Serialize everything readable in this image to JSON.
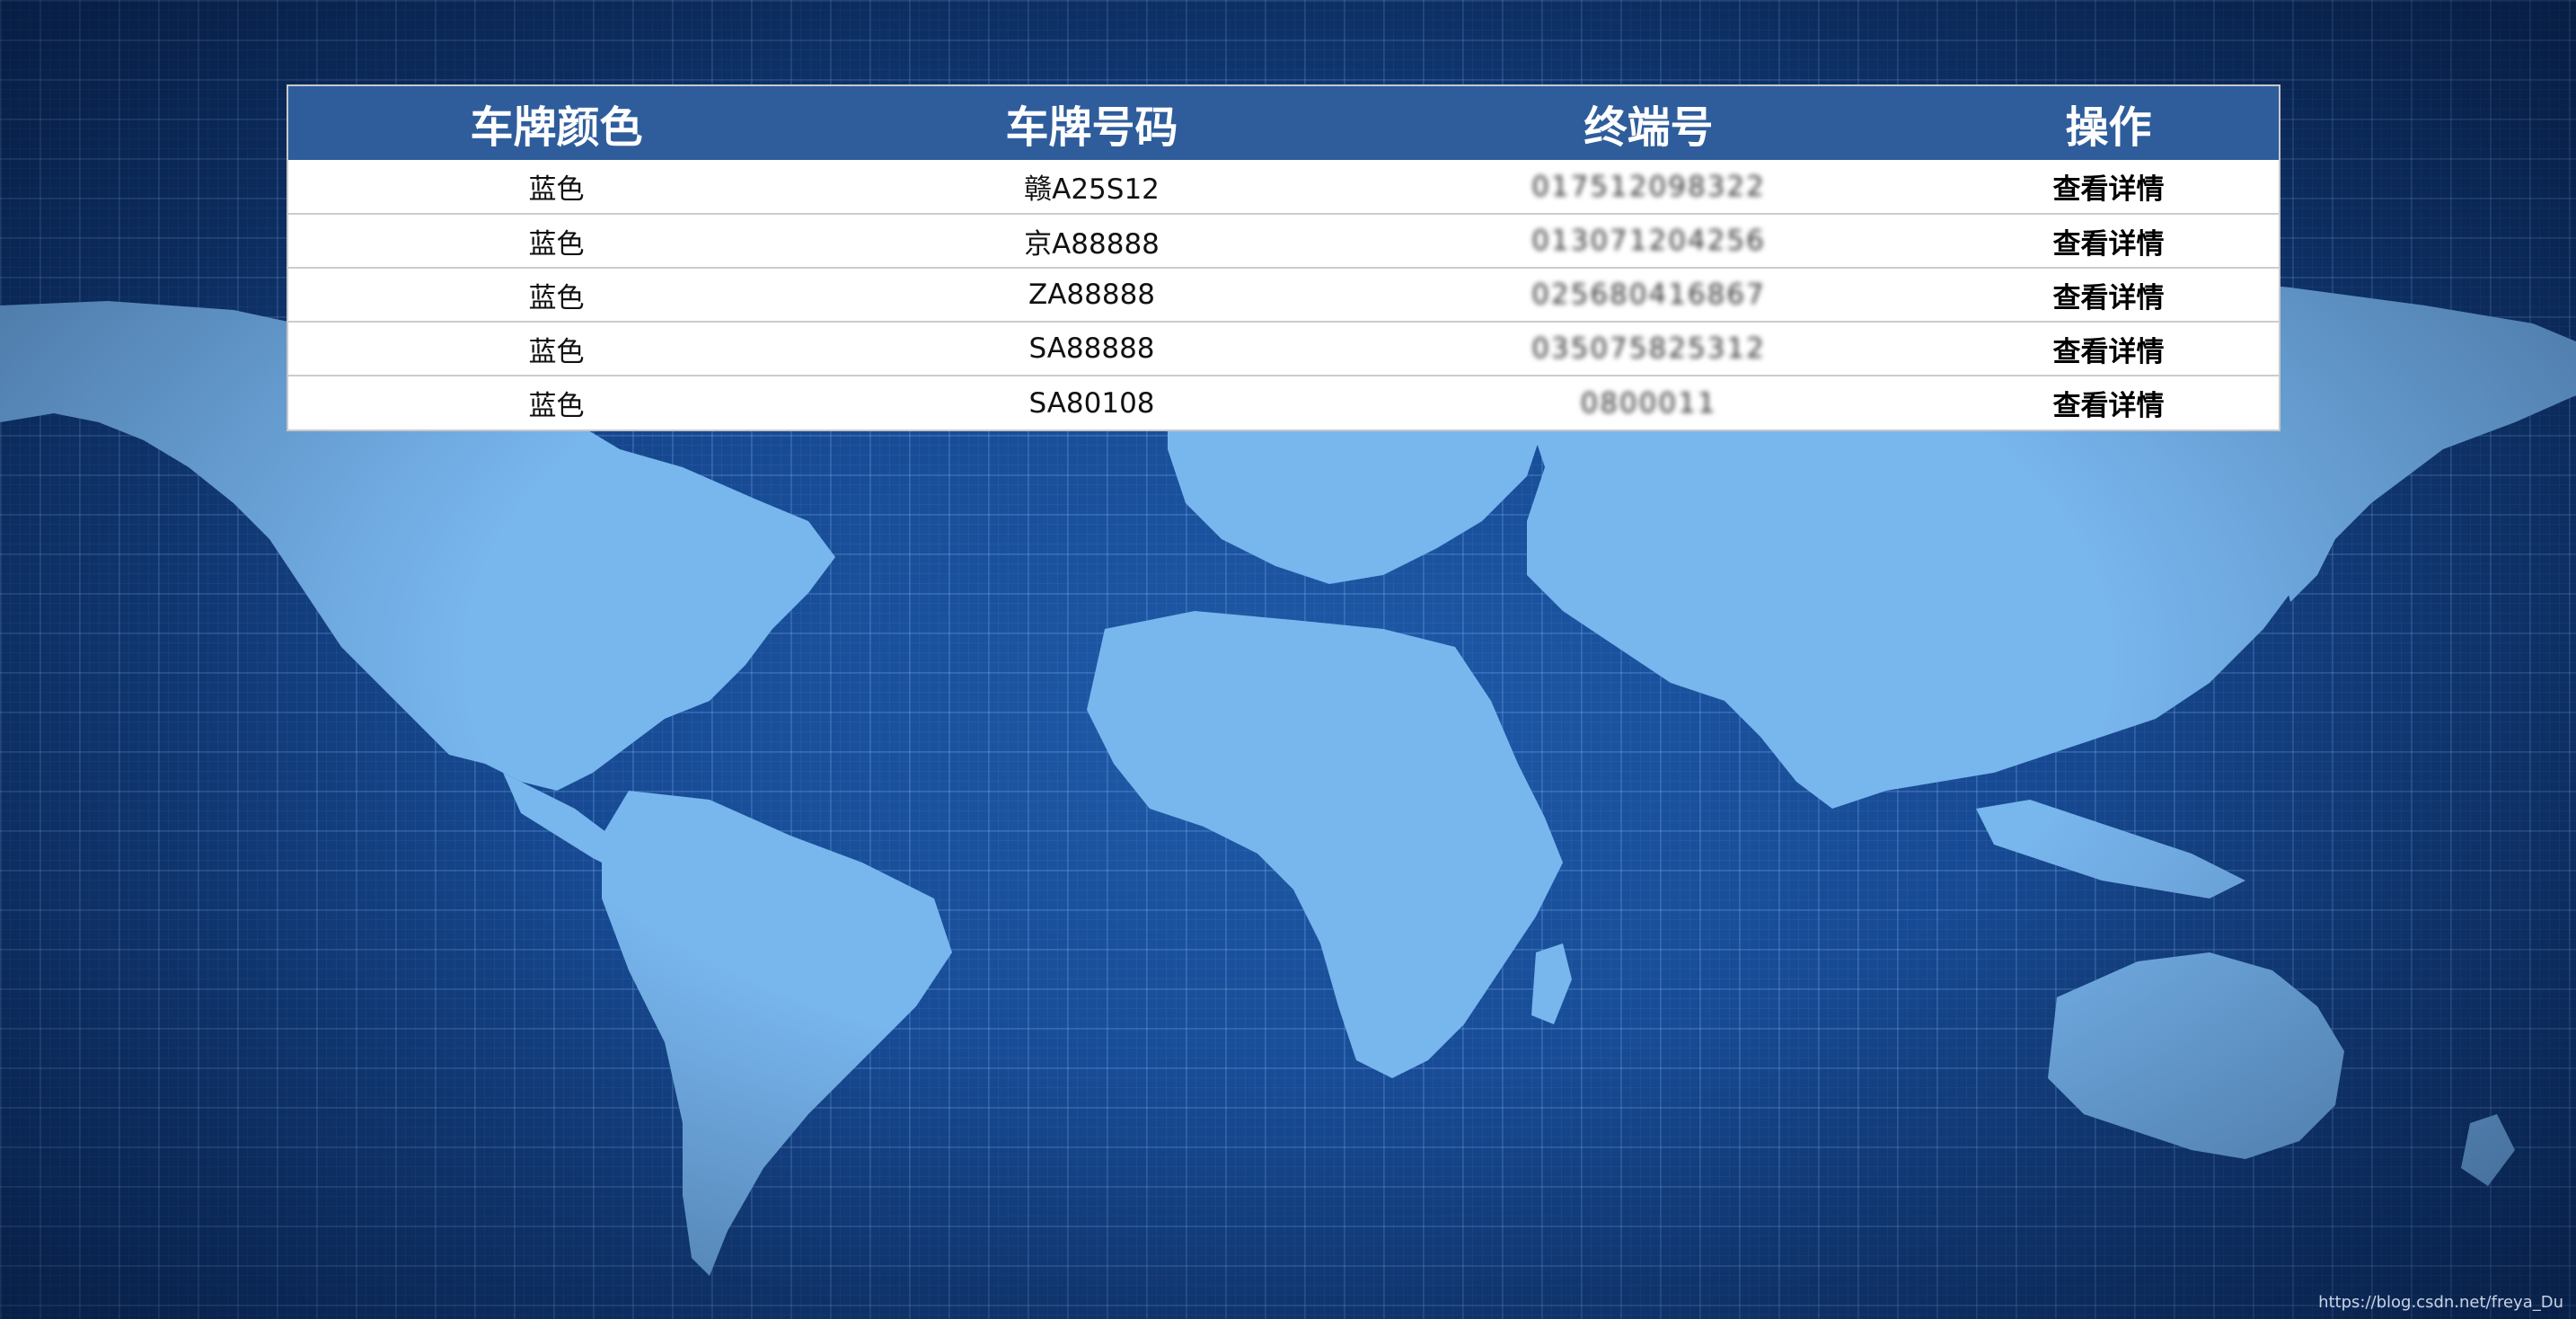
{
  "table": {
    "headers": [
      "车牌颜色",
      "车牌号码",
      "终端号",
      "操作"
    ],
    "rows": [
      {
        "color": "蓝色",
        "plate": "赣A25S12",
        "terminal": "017512098322",
        "action": "查看详情"
      },
      {
        "color": "蓝色",
        "plate": "京A88888",
        "terminal": "013071204256",
        "action": "查看详情"
      },
      {
        "color": "蓝色",
        "plate": "ZA88888",
        "terminal": "025680416867",
        "action": "查看详情"
      },
      {
        "color": "蓝色",
        "plate": "SA88888",
        "terminal": "035075825312",
        "action": "查看详情"
      },
      {
        "color": "蓝色",
        "plate": "SA80108",
        "terminal": "0800011",
        "action": "查看详情"
      }
    ]
  },
  "watermark": "https://blog.csdn.net/freya_Du",
  "colors": {
    "header_bg": "#2f5d9c",
    "background": "#174a93",
    "land": "#78b6ee"
  }
}
